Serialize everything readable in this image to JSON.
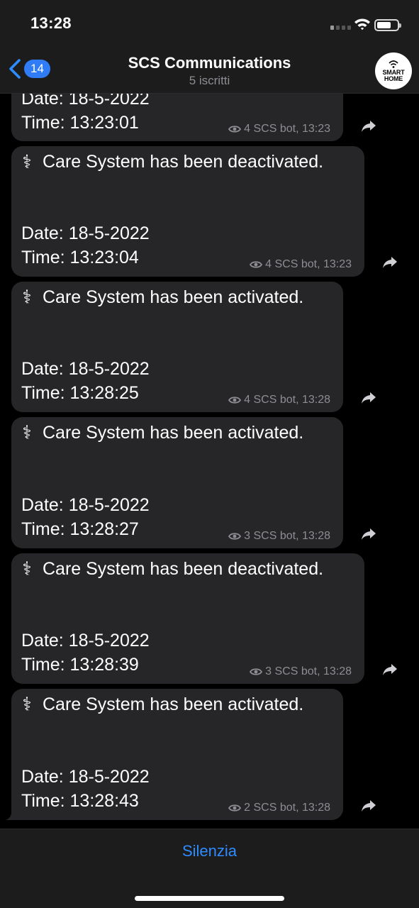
{
  "status_bar": {
    "time": "13:28",
    "icons": [
      "signal-icon",
      "wifi-icon",
      "battery-icon"
    ]
  },
  "nav": {
    "back_badge": "14",
    "title": "SCS Communications",
    "subtitle": "5 iscritti",
    "avatar_lines": [
      "SMART",
      "HOME"
    ]
  },
  "partial_message": {
    "date": "Date: 18-5-2022",
    "time": "Time: 13:23:01",
    "meta": "4 SCS bot, 13:23"
  },
  "messages": [
    {
      "icon": "medical-caduceus-icon",
      "text": "Care System has been deactivated.",
      "date": "Date: 18-5-2022",
      "time": "Time: 13:23:04",
      "meta": "4 SCS bot, 13:23"
    },
    {
      "icon": "medical-caduceus-icon",
      "text": "Care System has been activated.",
      "date": "Date: 18-5-2022",
      "time": "Time: 13:28:25",
      "meta": "4 SCS bot, 13:28"
    },
    {
      "icon": "medical-caduceus-icon",
      "text": "Care System has been activated.",
      "date": "Date: 18-5-2022",
      "time": "Time: 13:28:27",
      "meta": "3 SCS bot, 13:28"
    },
    {
      "icon": "medical-caduceus-icon",
      "text": "Care System has been deactivated.",
      "date": "Date: 18-5-2022",
      "time": "Time: 13:28:39",
      "meta": "3 SCS bot, 13:28"
    },
    {
      "icon": "medical-caduceus-icon",
      "text": "Care System has been activated.",
      "date": "Date: 18-5-2022",
      "time": "Time: 13:28:43",
      "meta": "2 SCS bot, 13:28"
    }
  ],
  "bottom": {
    "mute_label": "Silenzia"
  },
  "colors": {
    "accent": "#2f8cff",
    "badge": "#2f7cf6",
    "bubble": "#262628",
    "bar": "#1c1c1d",
    "meta": "#8d8d93"
  }
}
